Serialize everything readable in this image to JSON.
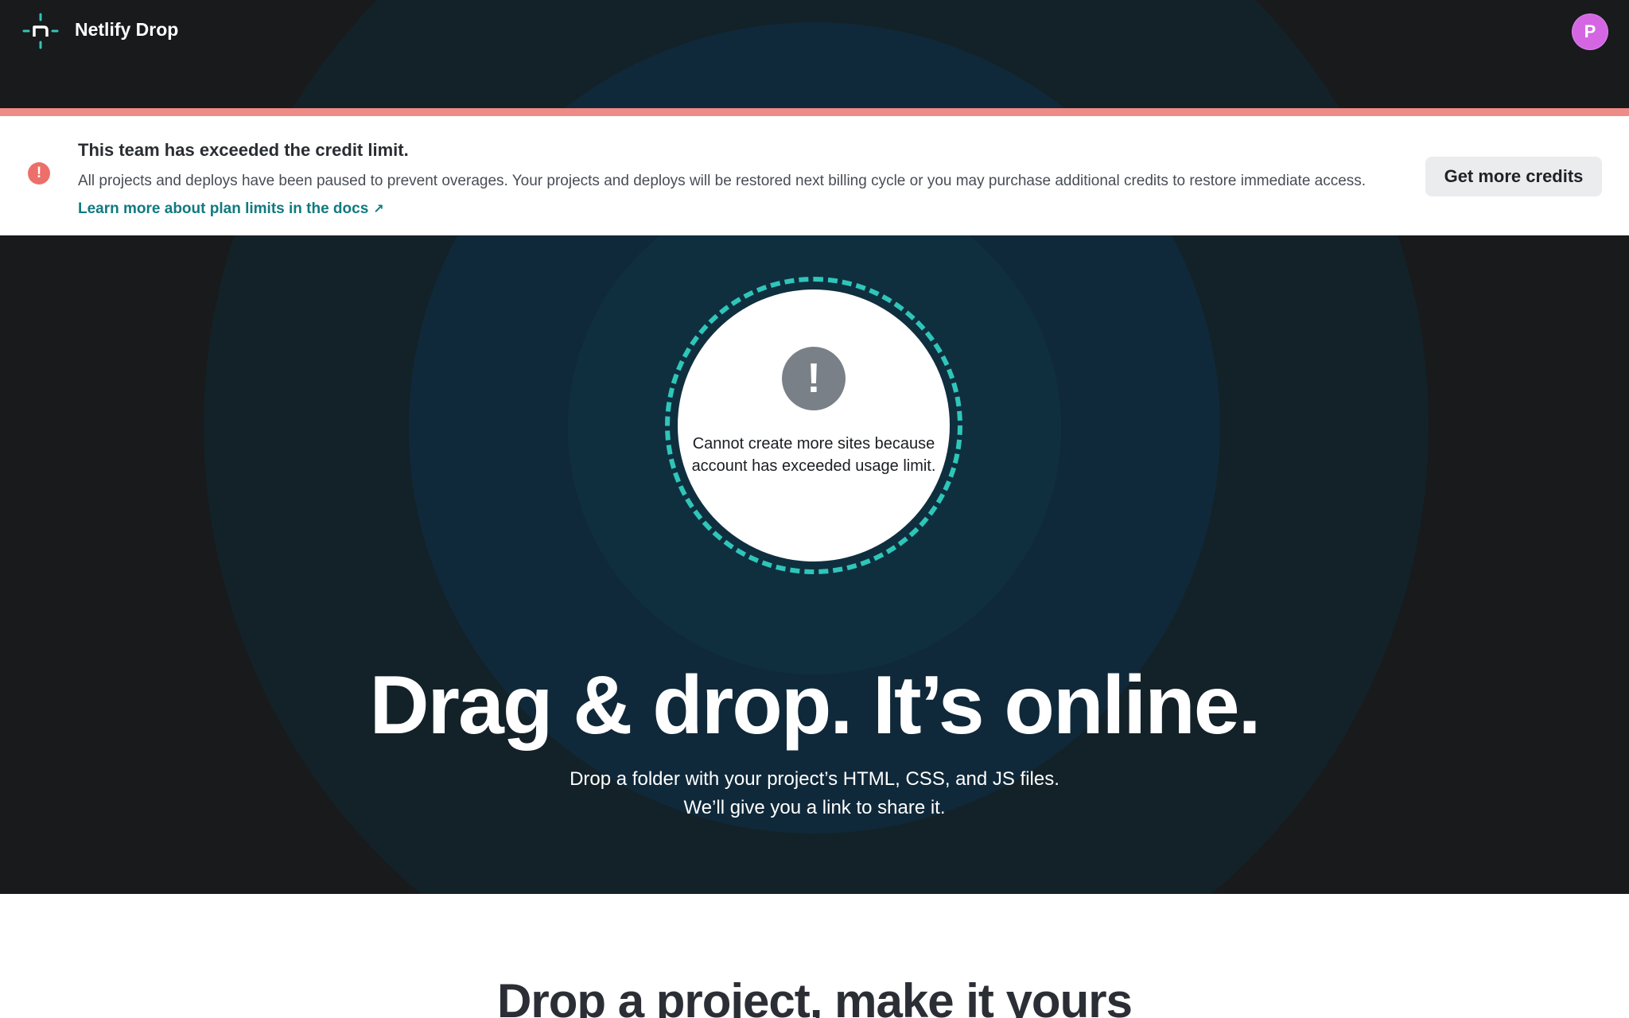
{
  "header": {
    "brand": "Netlify Drop",
    "avatar_initial": "P",
    "logo_icon": "netlify-logo-icon",
    "colors": {
      "logo": "#2fc6b9",
      "avatar": "#d466e3"
    }
  },
  "alert": {
    "title": "This team has exceeded the credit limit.",
    "body": "All projects and deploys have been paused to prevent overages. Your projects and deploys will be restored next billing cycle or you may purchase additional credits to restore immediate access. ",
    "link_label": "Learn more about plan limits in the docs",
    "link_arrow": "↗",
    "button_label": "Get more credits",
    "icon": "alert-exclamation-icon",
    "colors": {
      "strip": "#ef8b87",
      "icon": "#ec6f6a",
      "link": "#117a7f"
    }
  },
  "drop_zone": {
    "icon": "warning-exclamation-icon",
    "icon_glyph": "!",
    "message": "Cannot create more sites because account has exceeded usage limit.",
    "colors": {
      "dashed_border": "#2fc6b9",
      "icon": "#7a8088"
    }
  },
  "hero": {
    "headline": "Drag & drop. It’s online.",
    "sub_line_1": "Drop a folder with your project’s HTML, CSS, and JS files.",
    "sub_line_2": "We’ll give you a link to share it."
  },
  "lower": {
    "title": "Drop a project, make it yours"
  }
}
